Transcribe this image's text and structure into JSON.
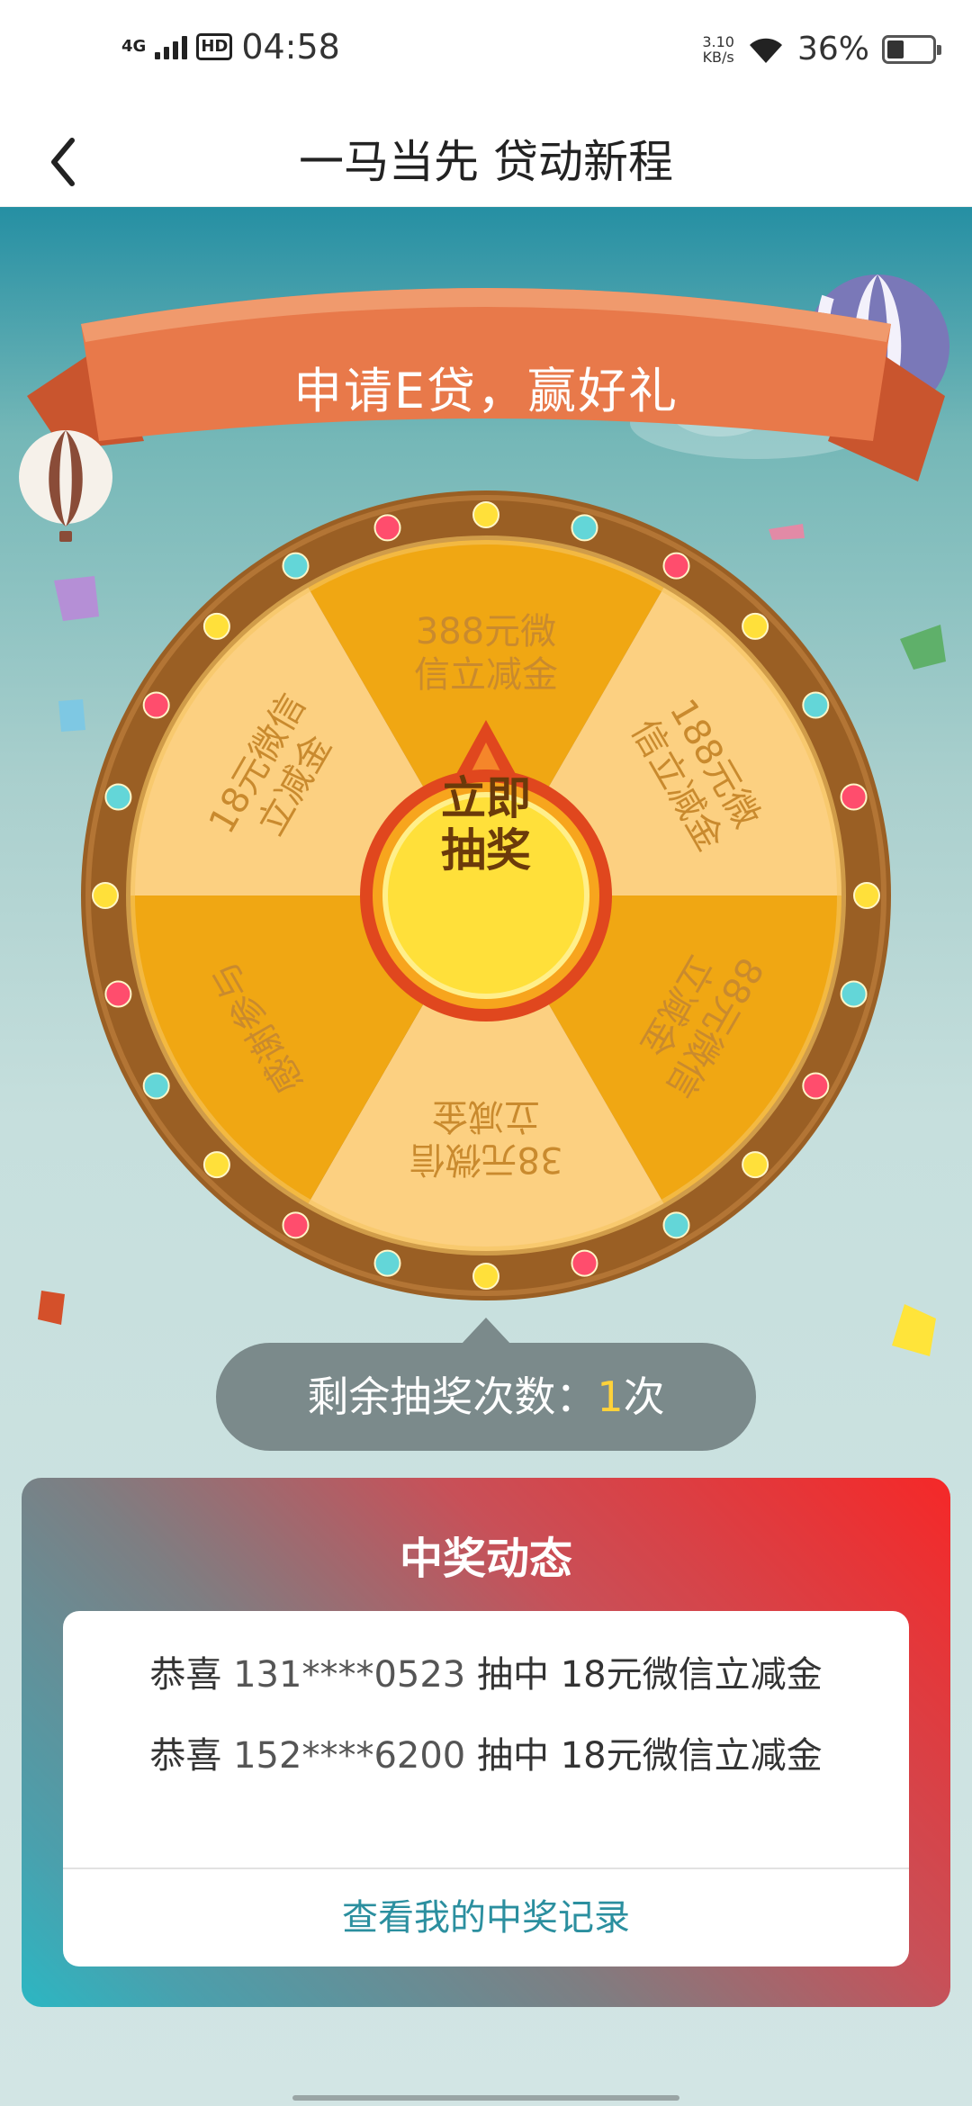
{
  "status_bar": {
    "network": "4G",
    "hd": "HD",
    "time": "04:58",
    "speed_value": "3.10",
    "speed_unit": "KB/s",
    "battery": "36%"
  },
  "nav": {
    "title": "一马当先 贷动新程",
    "back_icon": "chevron-left-icon"
  },
  "banner": {
    "text": "申请E贷，赢好礼",
    "color": "#e8794a"
  },
  "wheel": {
    "segments": [
      {
        "line1": "388元微",
        "line2": "信立减金"
      },
      {
        "line1": "188元微",
        "line2": "信立减金"
      },
      {
        "line1": "88元微信",
        "line2": "立减金"
      },
      {
        "line1": "38元微信",
        "line2": "立减金"
      },
      {
        "line1": "感谢参与",
        "line2": ""
      },
      {
        "line1": "18元微信",
        "line2": "立减金"
      }
    ],
    "spin_line1": "立即",
    "spin_line2": "抽奖",
    "colors": {
      "light_segment": "#fcd081",
      "dark_segment": "#f0a713",
      "rim": "#9a5f24",
      "button": "#ffe03a",
      "button_ring": "#e0471e"
    }
  },
  "remaining": {
    "label": "剩余抽奖次数：",
    "count": "1",
    "unit": "次"
  },
  "winners": {
    "title": "中奖动态",
    "items": [
      {
        "prefix": "恭喜 ",
        "phone": "131****0523",
        "suffix": " 抽中 18元微信立减金"
      },
      {
        "prefix": "恭喜 ",
        "phone": "152****6200",
        "suffix": " 抽中 18元微信立减金"
      }
    ],
    "link": "查看我的中奖记录"
  }
}
